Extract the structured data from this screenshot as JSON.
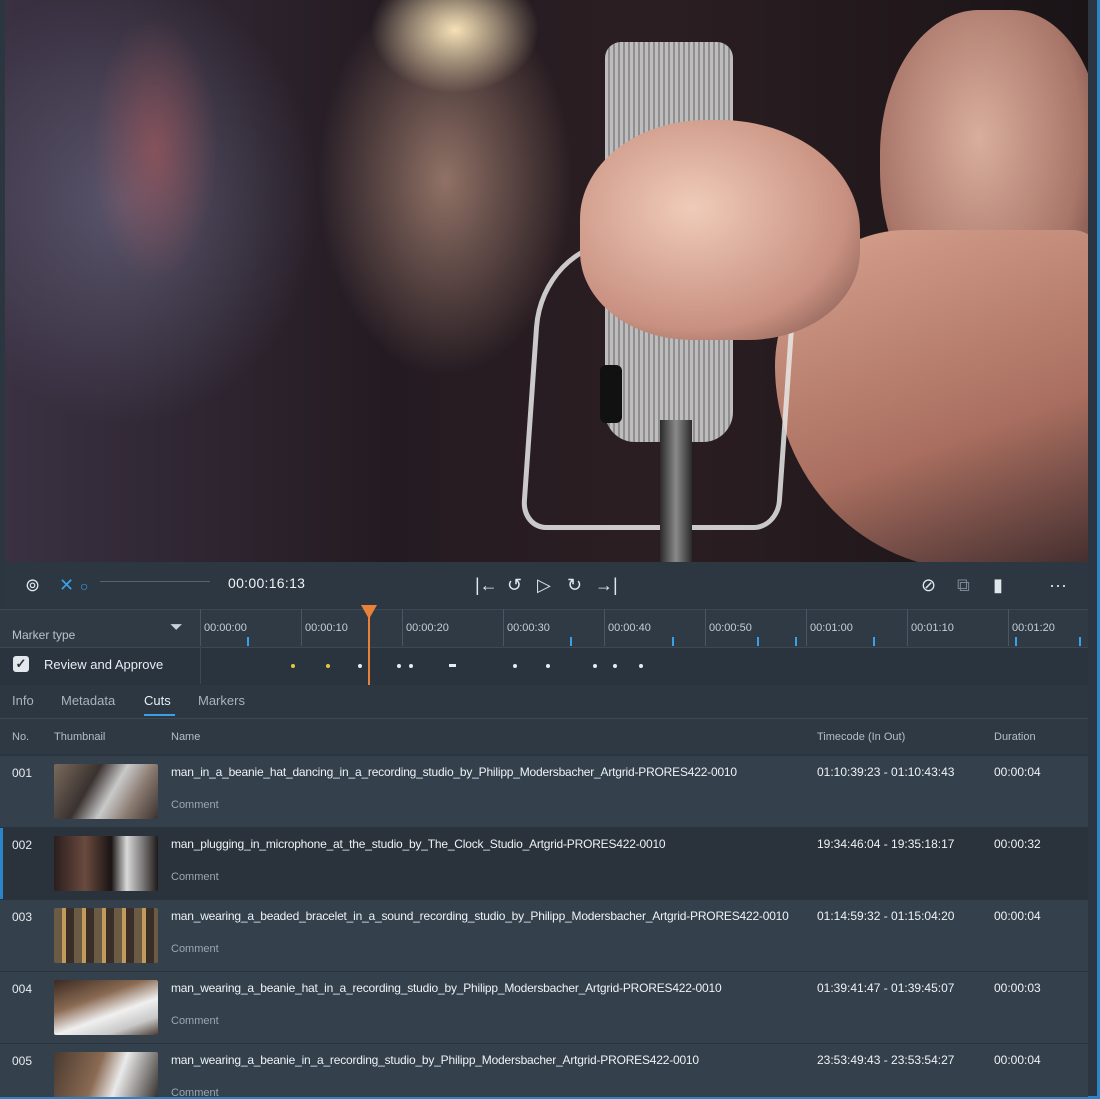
{
  "transport": {
    "timecode": "00:00:16:13"
  },
  "markers": {
    "label": "Marker type",
    "track_label": "Review and Approve",
    "ruler_ticks": [
      "00:00:00",
      "00:00:10",
      "00:00:20",
      "00:00:30",
      "00:00:40",
      "00:00:50",
      "00:01:00",
      "00:01:10",
      "00:01:20"
    ]
  },
  "tabs": [
    {
      "label": "Info"
    },
    {
      "label": "Metadata"
    },
    {
      "label": "Cuts"
    },
    {
      "label": "Markers"
    }
  ],
  "table": {
    "headers": {
      "no": "No.",
      "thumbnail": "Thumbnail",
      "name": "Name",
      "timecode": "Timecode (In Out)",
      "duration": "Duration"
    },
    "rows": [
      {
        "no": "001",
        "name": "man_in_a_beanie_hat_dancing_in_a_recording_studio_by_Philipp_Modersbacher_Artgrid-PRORES422-0010",
        "comment": "Comment",
        "timecode": "01:10:39:23 - 01:10:43:43",
        "duration": "00:00:04"
      },
      {
        "no": "002",
        "name": "man_plugging_in_microphone_at_the_studio_by_The_Clock_Studio_Artgrid-PRORES422-0010",
        "comment": "Comment",
        "timecode": "19:34:46:04 - 19:35:18:17",
        "duration": "00:00:32"
      },
      {
        "no": "003",
        "name": "man_wearing_a_beaded_bracelet_in_a_sound_recording_studio_by_Philipp_Modersbacher_Artgrid-PRORES422-0010",
        "comment": "Comment",
        "timecode": "01:14:59:32 - 01:15:04:20",
        "duration": "00:00:04"
      },
      {
        "no": "004",
        "name": "man_wearing_a_beanie_hat_in_a_recording_studio_by_Philipp_Modersbacher_Artgrid-PRORES422-0010",
        "comment": "Comment",
        "timecode": "01:39:41:47 - 01:39:45:07",
        "duration": "00:00:03"
      },
      {
        "no": "005",
        "name": "man_wearing_a_beanie_in_a_recording_studio_by_Philipp_Modersbacher_Artgrid-PRORES422-0010",
        "comment": "Comment",
        "timecode": "23:53:49:43 - 23:53:54:27",
        "duration": "00:00:04"
      }
    ]
  },
  "colors": {
    "accent": "#3aa0e8",
    "playhead": "#e8823a",
    "marker_yellow": "#e8c53a"
  },
  "icons": [
    "record-icon",
    "mute-icon",
    "loop-icon",
    "go-to-start-icon",
    "rewind-icon",
    "play-icon",
    "forward-icon",
    "go-to-end-icon",
    "hide-markers-icon",
    "copy-frame-icon",
    "marker-icon",
    "more-icon",
    "filter-icon",
    "check-icon"
  ]
}
